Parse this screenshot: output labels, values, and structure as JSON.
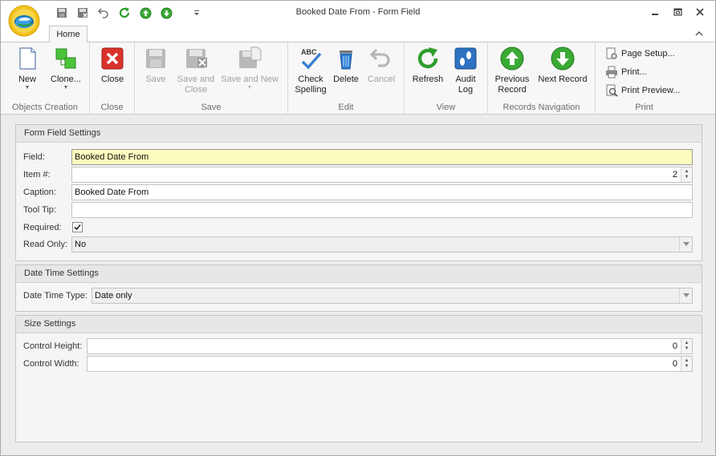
{
  "window": {
    "title": "Booked Date From - Form Field",
    "controls": [
      "minimize-icon",
      "restore-icon",
      "close-icon"
    ]
  },
  "quick_access": [
    "save-icon",
    "save-close-icon",
    "undo-icon",
    "refresh-icon",
    "previous-icon",
    "next-icon",
    "customize-dropdown-icon"
  ],
  "tabs": [
    {
      "label": "Home",
      "selected": true
    }
  ],
  "ribbon": {
    "groups": [
      {
        "label": "Objects Creation",
        "buttons": [
          {
            "label": "New",
            "has_dropdown": true
          },
          {
            "label": "Clone...",
            "has_dropdown": true
          }
        ]
      },
      {
        "label": "Close",
        "buttons": [
          {
            "label": "Close"
          }
        ]
      },
      {
        "label": "Save",
        "buttons": [
          {
            "label": "Save",
            "enabled": false
          },
          {
            "label": "Save and Close",
            "enabled": false
          },
          {
            "label": "Save and New",
            "enabled": false,
            "has_dropdown": true
          }
        ]
      },
      {
        "label": "Edit",
        "buttons": [
          {
            "label": "Check Spelling"
          },
          {
            "label": "Delete"
          },
          {
            "label": "Cancel",
            "enabled": false
          }
        ]
      },
      {
        "label": "View",
        "buttons": [
          {
            "label": "Refresh"
          },
          {
            "label": "Audit Log"
          }
        ]
      },
      {
        "label": "Records Navigation",
        "buttons": [
          {
            "label": "Previous Record"
          },
          {
            "label": "Next Record"
          }
        ]
      },
      {
        "label": "Print",
        "buttons": [
          {
            "label": "Page Setup..."
          },
          {
            "label": "Print..."
          },
          {
            "label": "Print Preview..."
          }
        ]
      }
    ],
    "icon_text": {
      "check_spelling": "ABC"
    }
  },
  "form_field_settings": {
    "title": "Form Field Settings",
    "field": {
      "label": "Field:",
      "value": "Booked Date From"
    },
    "item_no": {
      "label": "Item #:",
      "value": "2"
    },
    "caption": {
      "label": "Caption:",
      "value": "Booked Date From"
    },
    "tool_tip": {
      "label": "Tool Tip:",
      "value": ""
    },
    "required": {
      "label": "Required:",
      "checked": true
    },
    "read_only": {
      "label": "Read Only:",
      "value": "No"
    }
  },
  "date_time_settings": {
    "title": "Date Time Settings",
    "date_time_type": {
      "label": "Date Time Type:",
      "value": "Date only"
    }
  },
  "size_settings": {
    "title": "Size Settings",
    "control_height": {
      "label": "Control Height:",
      "value": "0"
    },
    "control_width": {
      "label": "Control Width:",
      "value": "0"
    }
  },
  "colors": {
    "highlight_field": "#fbfbbe",
    "accent_green": "#2e9e2e",
    "close_red": "#d9332b"
  }
}
